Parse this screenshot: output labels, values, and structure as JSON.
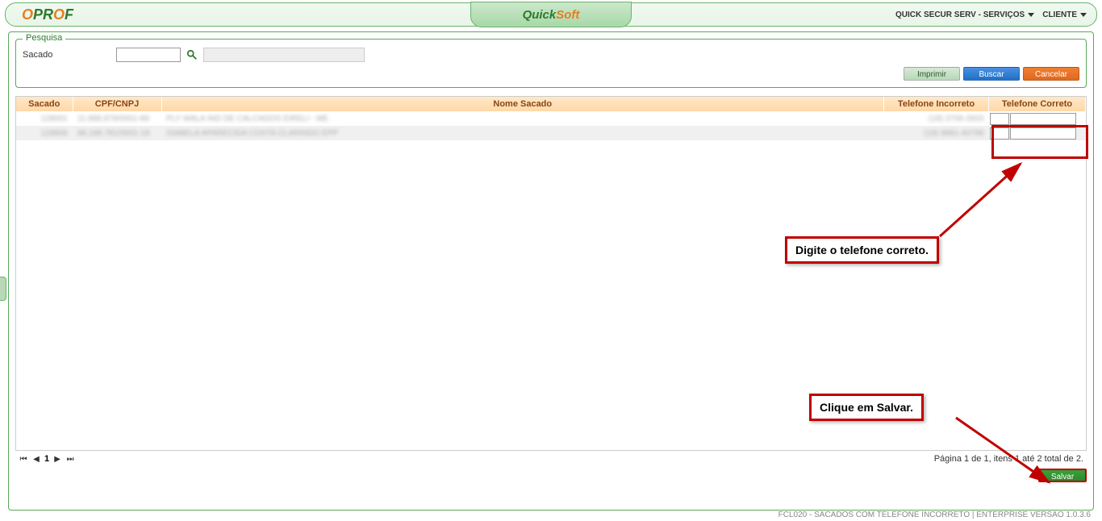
{
  "header": {
    "logo": "OPROF",
    "center_brand_a": "Quick",
    "center_brand_b": "Soft",
    "menu_service": "QUICK SECUR SERV - SERVIÇOS",
    "menu_client": "CLIENTE"
  },
  "search": {
    "legend": "Pesquisa",
    "label": "Sacado",
    "value": "",
    "display_value": ""
  },
  "buttons": {
    "print": "Imprimir",
    "search": "Buscar",
    "cancel": "Cancelar",
    "save": "Salvar"
  },
  "table": {
    "headers": {
      "sacado": "Sacado",
      "cpf": "CPF/CNPJ",
      "nome": "Nome Sacado",
      "tel_incorreto": "Telefone Incorreto",
      "tel_correto": "Telefone Correto"
    },
    "rows": [
      {
        "sacado": "128001",
        "cpf": "11.888.878/0001-89",
        "nome": "PLY WALA IND DE CALCADOS EIRELI - ME",
        "tel_incorreto": "(18) 3706-2603",
        "tel_ddd": "",
        "tel_num": ""
      },
      {
        "sacado": "128806",
        "cpf": "88.188.781/0001-18",
        "nome": "ISABELA APARECIDA COSTA CLARINDO EPP",
        "tel_incorreto": "(18) 9881-40788",
        "tel_ddd": "",
        "tel_num": ""
      }
    ]
  },
  "pagination": {
    "page": "1",
    "info": "Página 1 de 1, itens 1 até 2 total de 2."
  },
  "footer": "FCL020 - SACADOS COM TELEFONE INCORRETO | ENTERPRISE VERSÃO 1.0.3.6",
  "annotations": {
    "telefone": "Digite o telefone correto.",
    "salvar": "Clique em Salvar."
  }
}
